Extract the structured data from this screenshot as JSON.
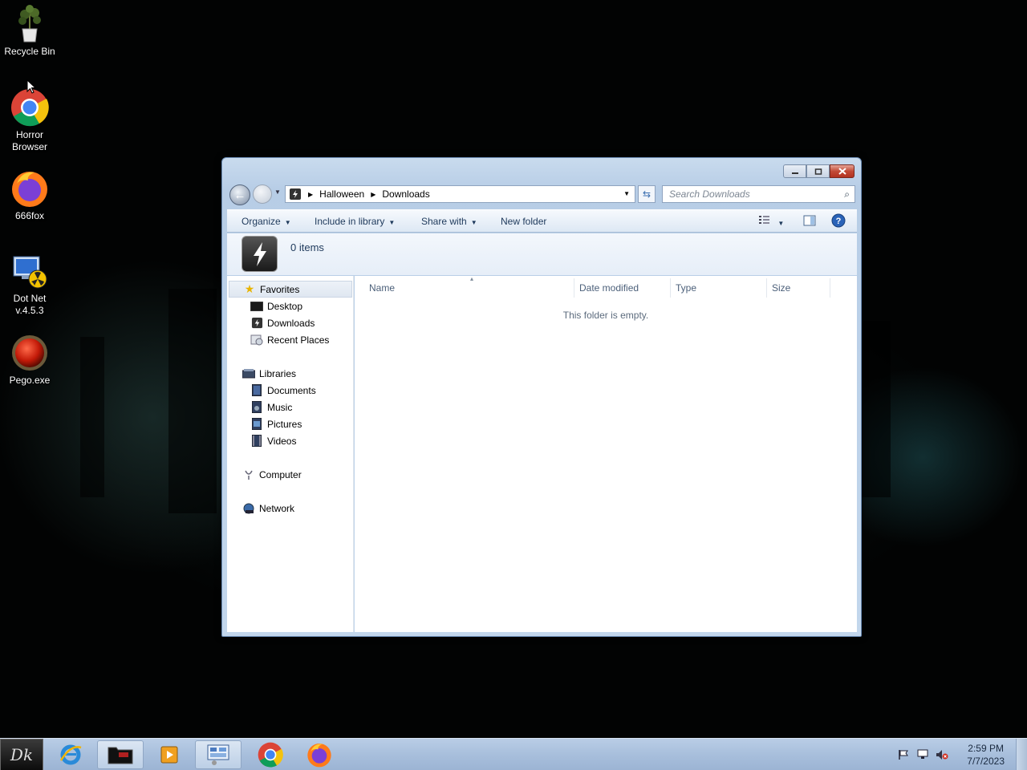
{
  "desktop": {
    "icons": [
      {
        "label": "Recycle Bin",
        "icon": "recycle-bin-plant-icon"
      },
      {
        "label": "Horror Browser",
        "icon": "chrome-icon"
      },
      {
        "label": "666fox",
        "icon": "firefox-icon"
      },
      {
        "label": "Dot Net v.4.5.3",
        "icon": "dotnet-installer-icon"
      },
      {
        "label": "Pego.exe",
        "icon": "red-orb-icon"
      }
    ]
  },
  "window": {
    "address": {
      "crumbs": [
        "Halloween",
        "Downloads"
      ]
    },
    "search": {
      "placeholder": "Search Downloads"
    },
    "toolbar": {
      "organize": "Organize",
      "include_in_library": "Include in library",
      "share_with": "Share with",
      "new_folder": "New folder"
    },
    "details": {
      "count_text": "0 items"
    },
    "nav": {
      "favorites": "Favorites",
      "desktop": "Desktop",
      "downloads": "Downloads",
      "recent_places": "Recent Places",
      "libraries": "Libraries",
      "documents": "Documents",
      "music": "Music",
      "pictures": "Pictures",
      "videos": "Videos",
      "computer": "Computer",
      "network": "Network"
    },
    "columns": {
      "name": "Name",
      "date_modified": "Date modified",
      "type": "Type",
      "size": "Size"
    },
    "empty_message": "This folder is empty."
  },
  "taskbar": {
    "start_logo": "Dk",
    "pinned": [
      "internet-explorer-icon",
      "folder-icon",
      "media-player-icon",
      "control-panel-icon",
      "chrome-icon",
      "firefox-icon"
    ],
    "clock": {
      "time": "2:59 PM",
      "date": "7/7/2023"
    }
  },
  "colors": {
    "accent": "#3a6fb0",
    "close_button": "#c24a36",
    "taskbar": "#a8bfdc"
  }
}
